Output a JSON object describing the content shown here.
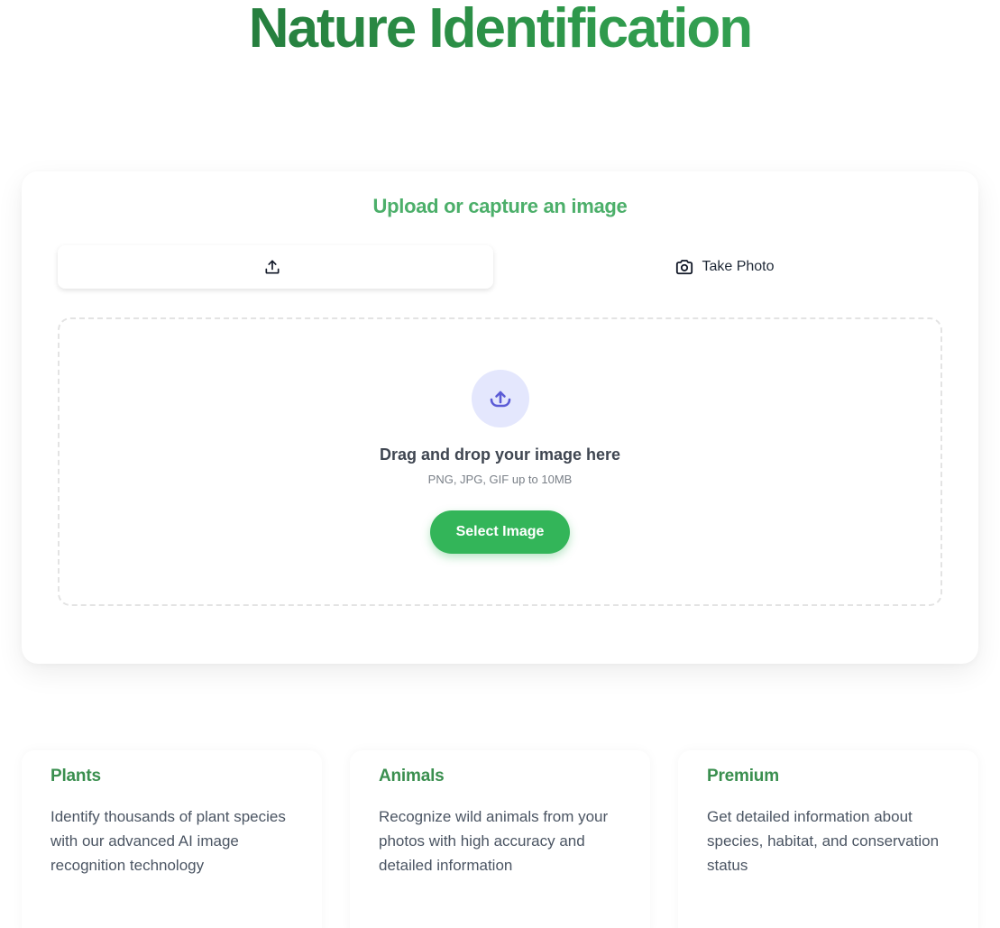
{
  "header": {
    "title": "Nature Identification"
  },
  "upload": {
    "title": "Upload or capture an image",
    "tabs": [
      {
        "label": "",
        "icon": "upload-icon",
        "active": true
      },
      {
        "label": "Take Photo",
        "icon": "camera-icon",
        "active": false
      }
    ],
    "dropzone": {
      "icon": "cloud-upload-icon",
      "title": "Drag and drop your image here",
      "hint": "PNG, JPG, GIF up to 10MB",
      "button_label": "Select Image"
    }
  },
  "features": [
    {
      "title": "Plants",
      "text": "Identify thousands of plant species with our advanced AI image recognition technology"
    },
    {
      "title": "Animals",
      "text": "Recognize wild animals from your photos with high accuracy and detailed information"
    },
    {
      "title": "Premium",
      "text": "Get detailed information about species, habitat, and conservation status"
    }
  ],
  "colors": {
    "brand_green": "#2f9a4c",
    "button_green": "#33b559",
    "icon_accent": "#5b5bd6",
    "icon_bg": "#e4e7fd"
  }
}
